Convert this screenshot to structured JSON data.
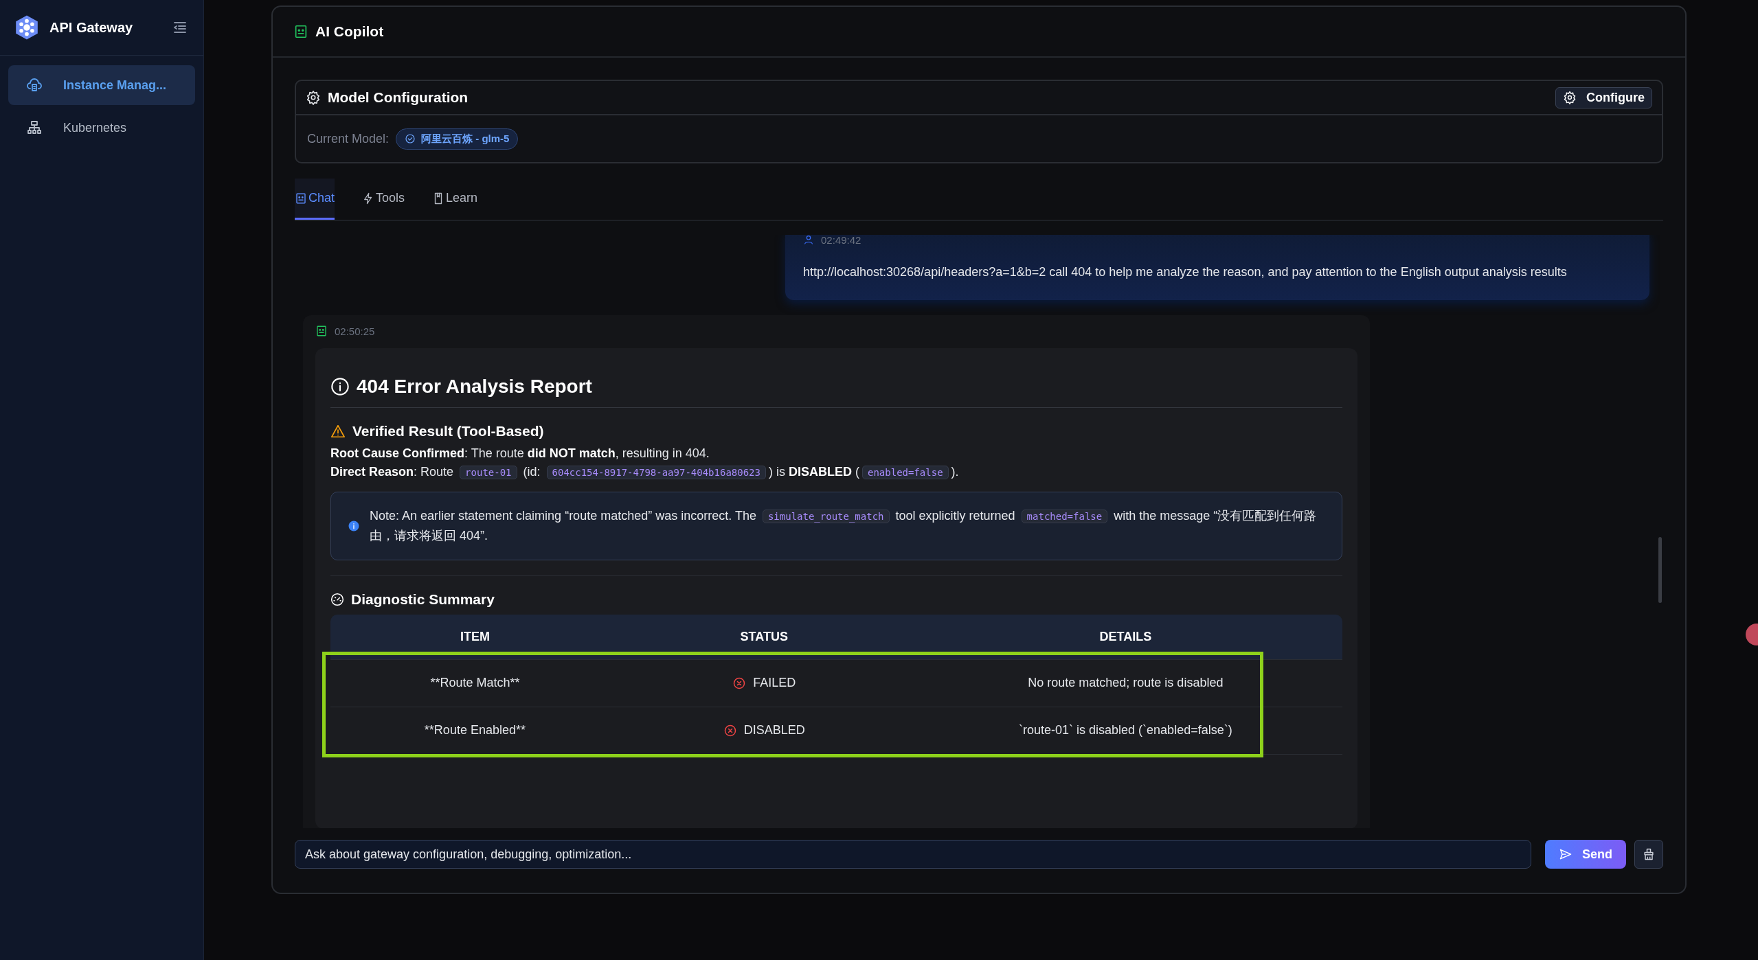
{
  "sidebar": {
    "title": "API Gateway",
    "items": [
      {
        "label": "Instance Manag...",
        "selected": true
      },
      {
        "label": "Kubernetes",
        "selected": false
      }
    ]
  },
  "panel": {
    "title": "AI Copilot"
  },
  "model_config": {
    "title": "Model Configuration",
    "button": "Configure",
    "current_label": "Current Model:",
    "model": "阿里云百炼 - glm-5"
  },
  "tabs": [
    {
      "label": "Chat",
      "selected": true
    },
    {
      "label": "Tools",
      "selected": false
    },
    {
      "label": "Learn",
      "selected": false
    }
  ],
  "messages": [
    {
      "kind": "user",
      "time": "02:49:42",
      "text": "http://localhost:30268/api/headers?a=1&b=2 call 404 to help me analyze the reason, and pay attention to the English output analysis results"
    },
    {
      "kind": "assistant",
      "time": "02:50:25",
      "report": {
        "title": "404 Error Analysis Report",
        "verified": {
          "heading": "Verified Result (Tool-Based)",
          "lines": [
            [
              {
                "text": "**Root Cause Confirmed**: The route **did NOT match**, resulting in 404."
              }
            ],
            [
              {
                "text": "**Direct Reason**: Route "
              },
              {
                "code": "route-01"
              },
              {
                "text": " (id: "
              },
              {
                "code": "604cc154-8917-4798-aa97-404b16a80623"
              },
              {
                "text": ") is **DISABLED** ("
              },
              {
                "code": "enabled=false"
              },
              {
                "text": ")."
              }
            ]
          ]
        },
        "note": [
          {
            "text": "Note: An earlier statement claiming “route matched” was incorrect. The "
          },
          {
            "code": "simulate_route_match"
          },
          {
            "text": " tool explicitly returned "
          },
          {
            "code": "matched=false"
          },
          {
            "text": " with the message “没有匹配到任何路由，请求将返回 404”."
          }
        ],
        "summary": {
          "heading": "Diagnostic Summary",
          "columns": [
            "ITEM",
            "STATUS",
            "DETAILS"
          ],
          "highlighted": true,
          "rows": [
            {
              "item": "**Route Match**",
              "status": "FAILED",
              "details": "No route matched; route is disabled"
            },
            {
              "item": "**Route Enabled**",
              "status": "DISABLED",
              "details": "`route-01` is disabled (`enabled=false`)"
            }
          ]
        }
      }
    }
  ],
  "input": {
    "placeholder": "Ask about gateway configuration, debugging, optimization...",
    "send": "Send"
  }
}
